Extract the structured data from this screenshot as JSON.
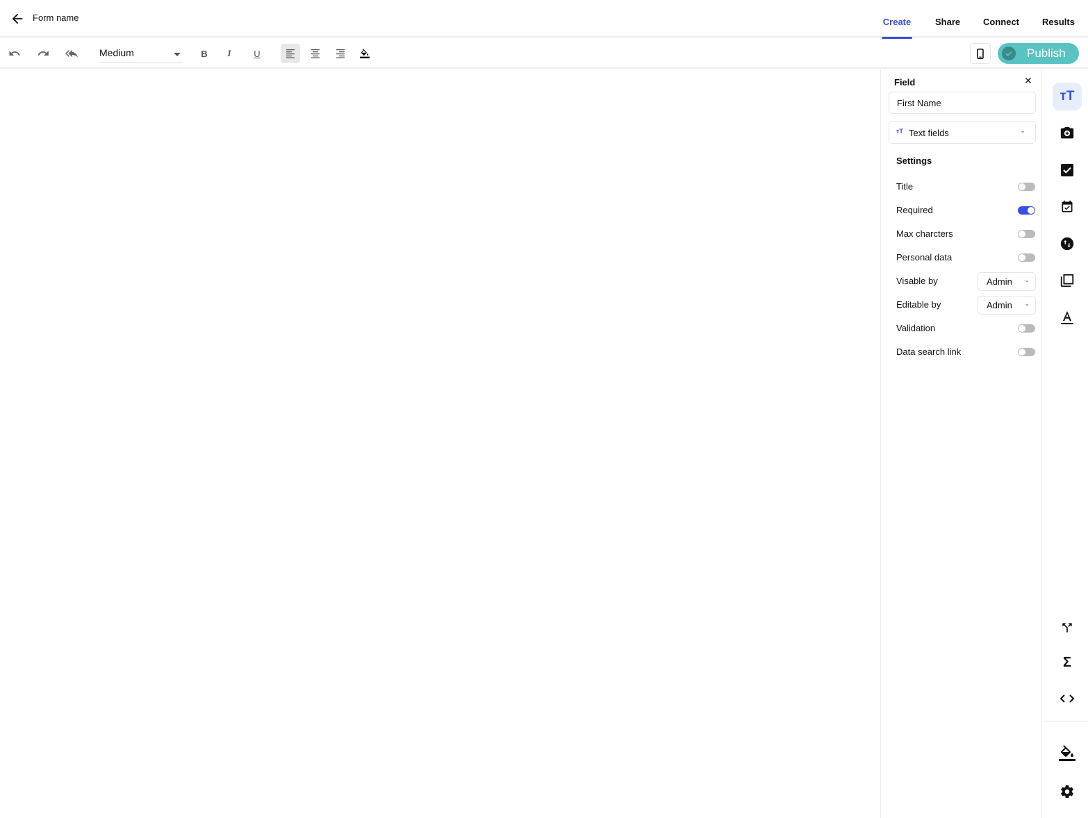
{
  "header": {
    "form_name": "Form name",
    "tabs": [
      {
        "label": "Create",
        "active": true
      },
      {
        "label": "Share",
        "active": false
      },
      {
        "label": "Connect",
        "active": false
      },
      {
        "label": "Results",
        "active": false
      }
    ]
  },
  "toolbar": {
    "font_weight": "Medium",
    "publish_label": "Publish",
    "accent_color": "#3a4ee0",
    "publish_color": "#58c3c2"
  },
  "field_panel": {
    "title": "Field",
    "name_value": "First Name",
    "type_label": "Text fields",
    "settings_title": "Settings",
    "settings": [
      {
        "label": "Title",
        "kind": "toggle",
        "on": false
      },
      {
        "label": "Required",
        "kind": "toggle",
        "on": true
      },
      {
        "label": "Max charcters",
        "kind": "toggle",
        "on": false
      },
      {
        "label": "Personal data",
        "kind": "toggle",
        "on": false
      },
      {
        "label": "Visable by",
        "kind": "select",
        "value": "Admin"
      },
      {
        "label": "Editable by",
        "kind": "select",
        "value": "Admin"
      },
      {
        "label": "Validation",
        "kind": "toggle",
        "on": false
      },
      {
        "label": "Data search link",
        "kind": "toggle",
        "on": false
      }
    ]
  },
  "rail": {
    "top_items": [
      "text-fields-icon",
      "add-photo-icon",
      "checkbox-icon",
      "date-icon",
      "swap-icon",
      "library-icon",
      "text-format-icon"
    ],
    "bottom_items": [
      "branch-icon",
      "sigma-icon",
      "code-icon",
      "fill-color-icon",
      "settings-gear-icon"
    ]
  }
}
